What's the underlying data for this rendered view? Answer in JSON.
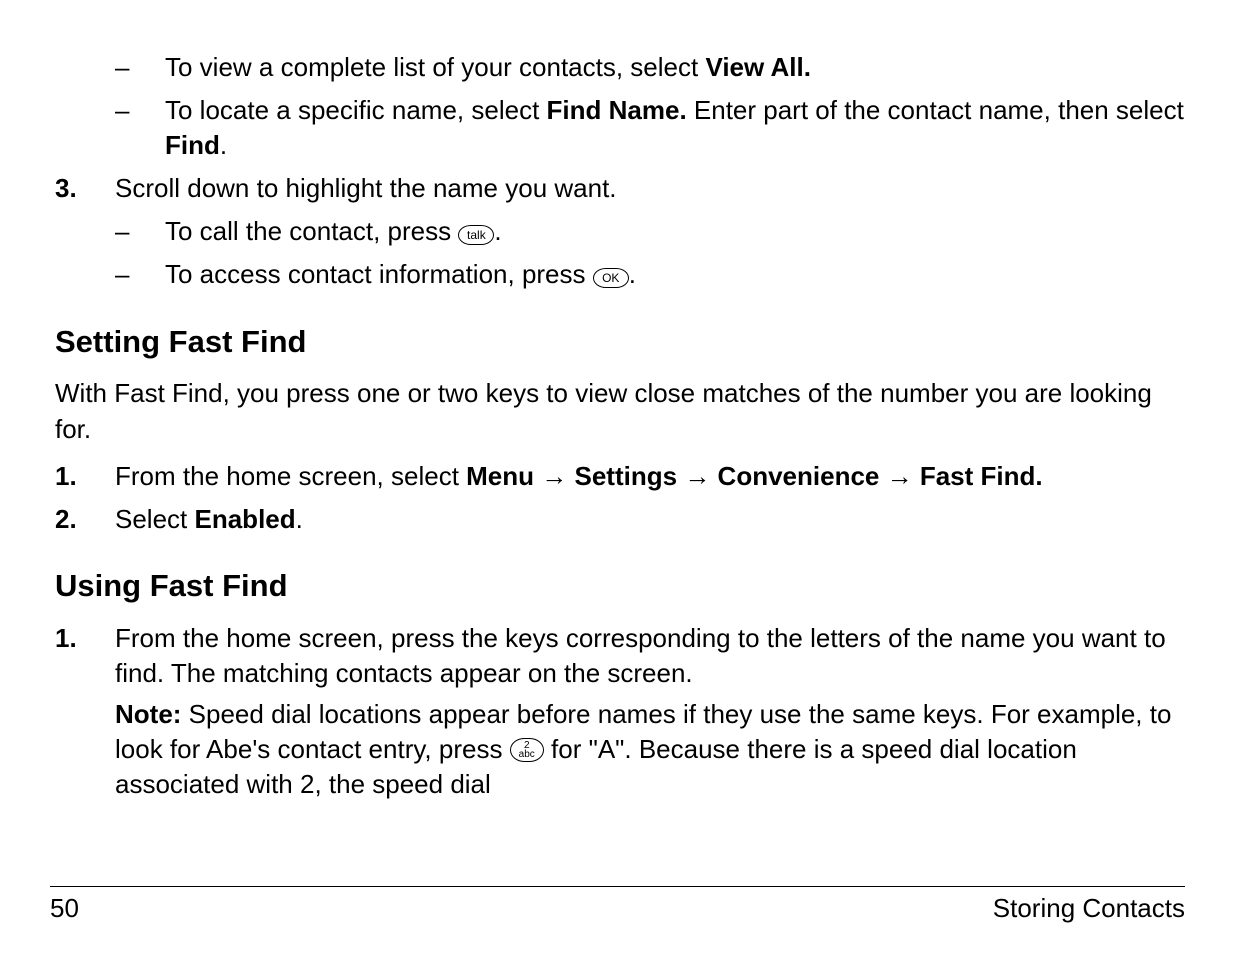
{
  "top_sub_items": [
    {
      "prefix": "To view a complete list of your contacts, select ",
      "bold1": "View All.",
      "after1": ""
    },
    {
      "prefix": "To locate a specific name, select ",
      "bold1": "Find Name. ",
      "after1": "Enter part of the contact name, then select ",
      "bold2": "Find",
      "after2": "."
    }
  ],
  "step3_marker": "3.",
  "step3_text": "Scroll down to highlight the name you want.",
  "step3_sub": [
    {
      "prefix": "To call the contact, press ",
      "icon": "talk",
      "suffix": "."
    },
    {
      "prefix": "To access contact information, press ",
      "icon": "ok",
      "suffix": "."
    }
  ],
  "heading1": "Setting Fast Find",
  "para1": "With Fast Find, you press one or two keys to view close matches of the number you are looking for.",
  "setting_steps": {
    "s1_marker": "1.",
    "s1_prefix": "From the home screen, select ",
    "s1_path": [
      "Menu",
      "Settings",
      "Convenience",
      "Fast Find."
    ],
    "s2_marker": "2.",
    "s2_prefix": "Select ",
    "s2_bold": "Enabled",
    "s2_suffix": "."
  },
  "heading2": "Using Fast Find",
  "using_steps": {
    "s1_marker": "1.",
    "s1_text": "From the home screen, press the keys corresponding to the letters of the name you want to find. The matching contacts appear on the screen.",
    "note_label": "Note: ",
    "note_pre": "Speed dial locations appear before names if they use the same keys. For example, to look for Abe's contact entry, press ",
    "note_icon": "2abc",
    "note_post": " for \"A\". Because there is a speed dial location associated with 2, the speed dial"
  },
  "icons": {
    "talk": "talk",
    "ok": "OK",
    "two_top": "2",
    "two_bot": "abc"
  },
  "arrow_glyph": "→",
  "footer": {
    "page": "50",
    "section": "Storing Contacts"
  },
  "dash": "–"
}
